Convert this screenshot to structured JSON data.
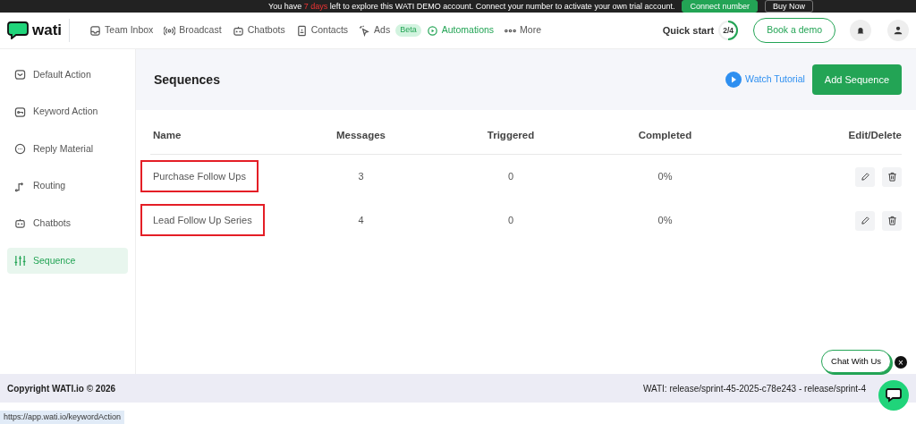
{
  "banner": {
    "text": "You have **7 days** left to explore this WATI DEMO account. Connect your number to activate your own trial account.",
    "buttons": [
      {
        "label": "Connect number",
        "kind": "primary"
      },
      {
        "label": "Buy Now",
        "kind": "outline"
      }
    ]
  },
  "navbar": {
    "logo": "wati",
    "items": [
      {
        "label": "Team Inbox",
        "selected": false
      },
      {
        "label": "Broadcast",
        "selected": false
      },
      {
        "label": "Chatbots",
        "selected": false
      },
      {
        "label": "Contacts",
        "selected": false
      },
      {
        "label": "Ads",
        "selected": false,
        "badge": "Beta"
      },
      {
        "label": "Automations",
        "selected": true
      },
      {
        "label": "More",
        "selected": false
      }
    ],
    "quick_start": {
      "label": "Quick start",
      "progress": "2/4",
      "level": 0.5
    },
    "book_demo": "Book a demo"
  },
  "sidebar": {
    "items": [
      {
        "label": "Default Action",
        "selected": false
      },
      {
        "label": "Keyword Action",
        "selected": false
      },
      {
        "label": "Reply Material",
        "selected": false
      },
      {
        "label": "Routing",
        "selected": false
      },
      {
        "label": "Chatbots",
        "selected": false
      },
      {
        "label": "Sequence",
        "selected": true
      }
    ]
  },
  "page": {
    "title": "Sequences",
    "watch_tutorial": "Watch Tutorial",
    "add_button": "Add Sequence"
  },
  "table": {
    "columns": [
      "Name",
      "Messages",
      "Triggered",
      "Completed",
      "Edit/Delete"
    ],
    "rows": [
      {
        "name": "Purchase Follow Ups",
        "messages": "3",
        "triggered": "0",
        "completed": "0%",
        "annotated": true
      },
      {
        "name": "Lead Follow Up Series",
        "messages": "4",
        "triggered": "0",
        "completed": "0%",
        "annotated": true
      }
    ]
  },
  "chat_widget": {
    "label": "Chat With Us",
    "close": "×"
  },
  "footer": {
    "copyright": "Copyright WATI.io © 2026",
    "version": "WATI: release/sprint-45-2025-c78e243 - release/sprint-4"
  },
  "status_bar": {
    "url": "https://app.wati.io/keywordAction"
  }
}
